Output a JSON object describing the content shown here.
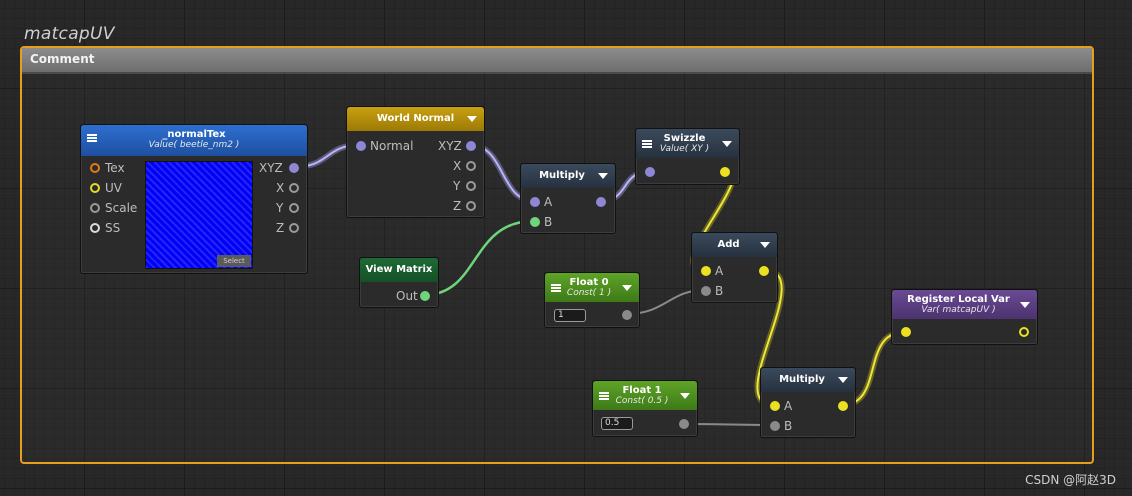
{
  "comment": {
    "title": "matcapUV",
    "label": "Comment"
  },
  "nodes": {
    "normal_tex": {
      "title": "_normalTex",
      "subtitle": "Value( beetle_nm2 )",
      "inputs": [
        "Tex",
        "UV",
        "Scale",
        "SS"
      ],
      "outputs": [
        "XYZ",
        "X",
        "Y",
        "Z"
      ],
      "select_label": "Select"
    },
    "world_normal": {
      "title": "World Normal",
      "input": "Normal",
      "outputs": [
        "XYZ",
        "X",
        "Y",
        "Z"
      ]
    },
    "multiply1": {
      "title": "Multiply",
      "inputs": [
        "A",
        "B"
      ]
    },
    "swizzle": {
      "title": "Swizzle",
      "subtitle": "Value( XY )"
    },
    "view_matrix": {
      "title": "View Matrix",
      "output": "Out"
    },
    "add": {
      "title": "Add",
      "inputs": [
        "A",
        "B"
      ]
    },
    "float0": {
      "title": "Float 0",
      "subtitle": "Const( 1 )",
      "value": "1"
    },
    "register_local_var": {
      "title": "Register Local Var",
      "subtitle": "Var( matcapUV )"
    },
    "float1": {
      "title": "Float 1",
      "subtitle": "Const( 0.5 )",
      "value": "0.5"
    },
    "multiply2": {
      "title": "Multiply",
      "inputs": [
        "A",
        "B"
      ]
    }
  },
  "colors": {
    "comment_border": "#e79d1d",
    "wire_vector3": "#8d87c9",
    "wire_vector2": "#d8cf2e",
    "wire_float": "#8a8a8a",
    "wire_matrix": "#6fd47a"
  },
  "watermark": "CSDN @阿赵3D"
}
